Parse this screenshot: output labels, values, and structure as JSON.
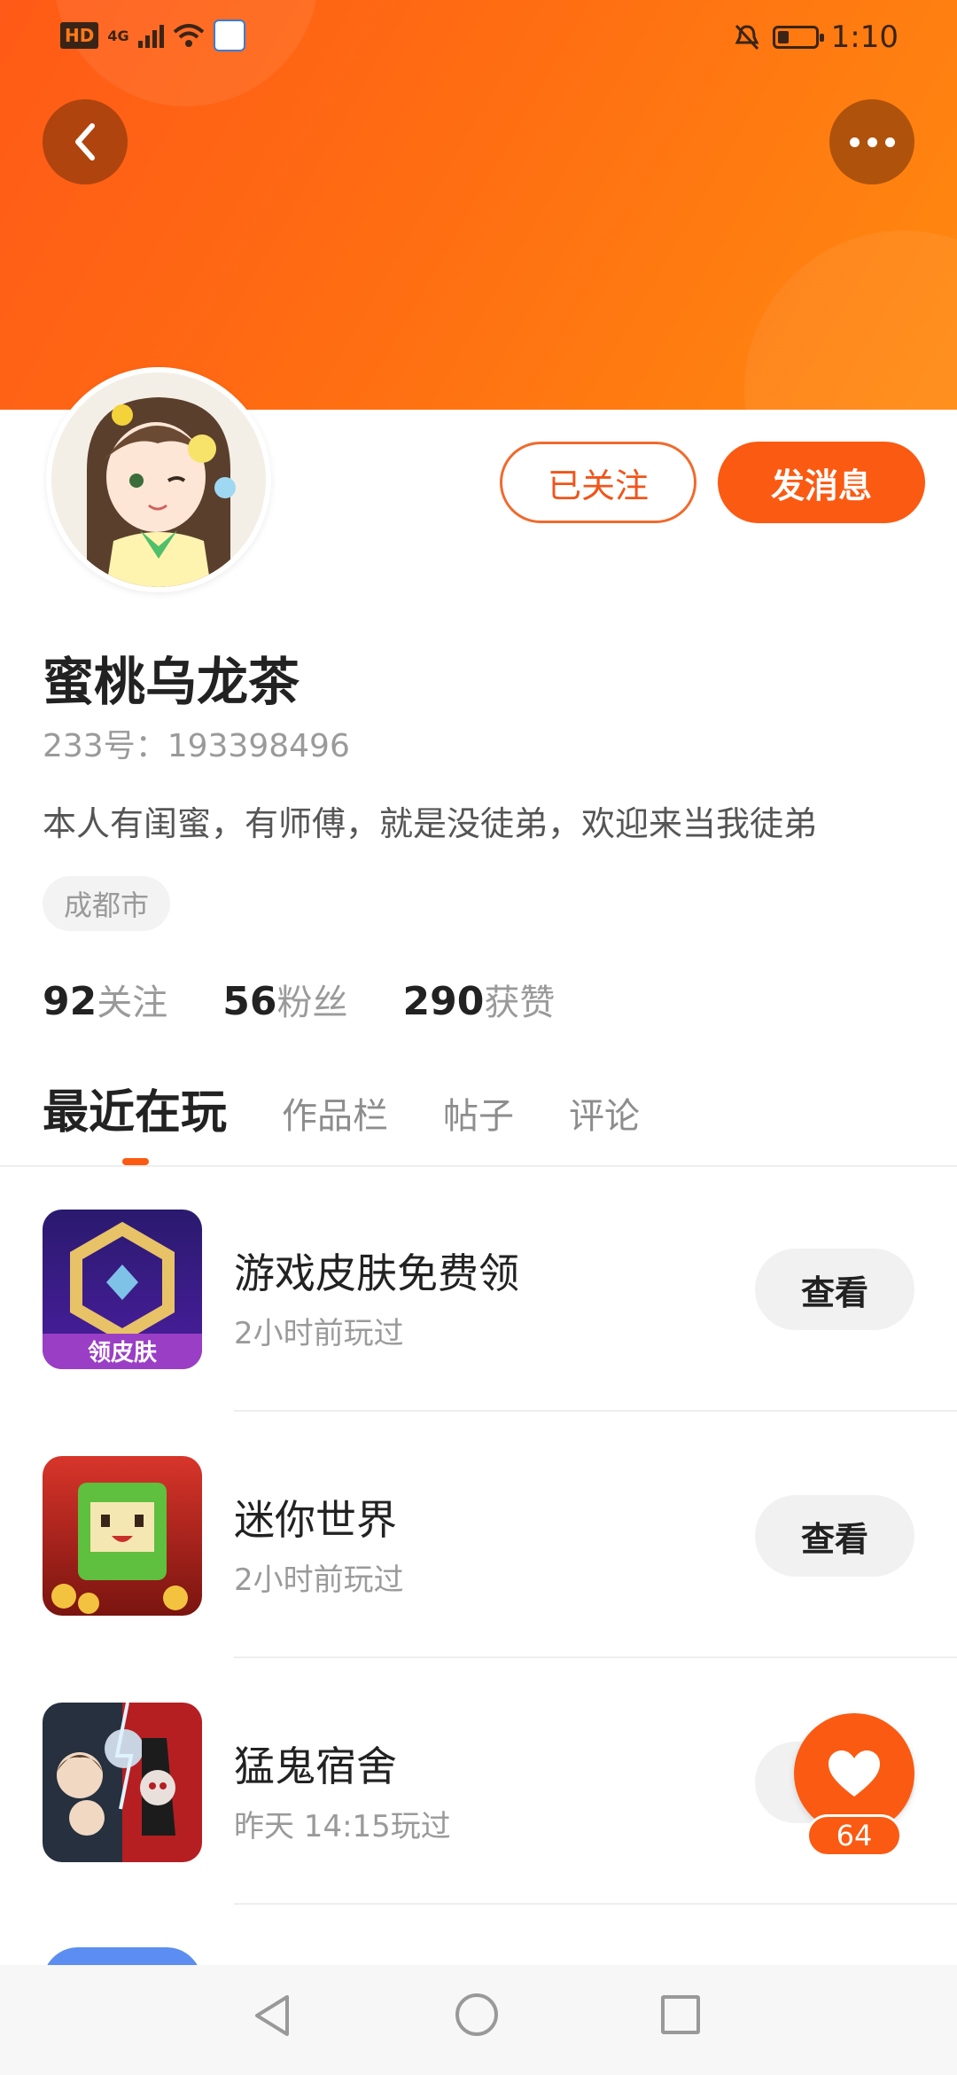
{
  "status_bar": {
    "network_badge": "HD",
    "network_type": "4G",
    "time": "1:10"
  },
  "profile": {
    "nickname": "蜜桃乌龙茶",
    "id_text": "233号：193398496",
    "bio": "本人有闺蜜，有师傅，就是没徒弟，欢迎来当我徒弟",
    "city": "成都市",
    "follow_button": "已关注",
    "message_button": "发消息"
  },
  "stats": [
    {
      "value": "92",
      "label": "关注"
    },
    {
      "value": "56",
      "label": "粉丝"
    },
    {
      "value": "290",
      "label": "获赞"
    }
  ],
  "tabs": [
    "最近在玩",
    "作品栏",
    "帖子",
    "评论"
  ],
  "games": [
    {
      "name": "游戏皮肤免费领",
      "time": "2小时前玩过",
      "button": "查看",
      "icon_text": "领皮肤"
    },
    {
      "name": "迷你世界",
      "time": "2小时前玩过",
      "button": "查看"
    },
    {
      "name": "猛鬼宿舍",
      "time": "昨天 14:15玩过",
      "button": "查看"
    }
  ],
  "like": {
    "count": "64"
  },
  "icons": {
    "back": "chevron-left-icon",
    "more": "more-dots-icon",
    "like": "heart-icon",
    "nav": [
      "nav-back-icon",
      "nav-home-icon",
      "nav-recent-icon"
    ]
  },
  "colors": {
    "accent": "#fb5a12",
    "banner_start": "#ff5a17",
    "banner_end": "#ff8a10"
  }
}
